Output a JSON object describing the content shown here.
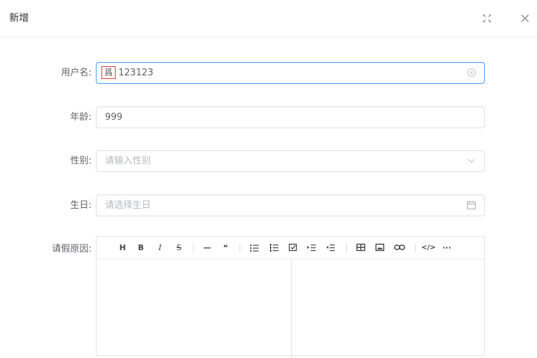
{
  "dialog": {
    "title": "新增"
  },
  "form": {
    "username": {
      "label": "用户名:",
      "ime_indicator": "爲",
      "value": "123123"
    },
    "age": {
      "label": "年龄:",
      "value": "999"
    },
    "gender": {
      "label": "性别:",
      "placeholder": "请输入性别"
    },
    "birthday": {
      "label": "生日:",
      "placeholder": "请选择生日"
    },
    "leave_reason": {
      "label": "请假原因:"
    }
  },
  "toolbar": {
    "heading": "H",
    "bold": "B",
    "italic": "I",
    "strikethrough": "S",
    "horizontal_rule": "—",
    "quote": "❝",
    "code": "</>",
    "more": "···"
  },
  "colors": {
    "focus_border": "#409eff",
    "ime_box": "#d9393e"
  }
}
